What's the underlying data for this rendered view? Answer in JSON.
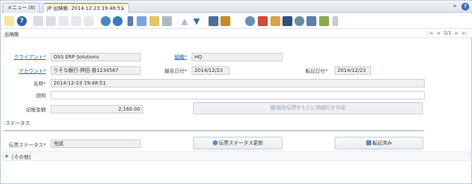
{
  "tabs": {
    "menu_label": "メニュー (8)",
    "active_label": "JP 出納帳: 2014-12-23 19:48:51",
    "close_glyph": "×"
  },
  "toolbar": {
    "icons": [
      "ignore-icon",
      "help-icon",
      "new-icon",
      "copy-icon",
      "delete-icon",
      "save-icon",
      "save-new-icon",
      "refresh-icon",
      "find-icon",
      "attachment-icon",
      "chat-icon",
      "history-icon",
      "report-icon",
      "up-icon",
      "down-icon",
      "detail-icon",
      "archive-icon",
      "zoom-icon",
      "translate-icon",
      "workflow-icon",
      "product-info-icon",
      "request-icon",
      "process-icon",
      "export-icon",
      "customize-icon"
    ]
  },
  "title": {
    "page_title": "出納帳",
    "pager_count": "1/1"
  },
  "form": {
    "client_label": "クライアント",
    "client_value": "OSS ERP Solutions",
    "org_label": "組織",
    "org_value": "HQ",
    "account_label": "アカウント",
    "account_value": "りそな銀行-押田-普1234567",
    "report_date_label": "報告日付",
    "report_date_value": "2014/12/23",
    "posting_date_label": "転記日付",
    "posting_date_value": "2014/12/23",
    "name_label": "名称",
    "name_value": "2014-12-23 19:48:51",
    "description_label": "説明",
    "description_value": "",
    "amount_label": "記帳金額",
    "amount_value": "2,160.00",
    "create_from_button": "既存伝票をもとに明細行を作成",
    "status_section": "ステータス",
    "doc_status_label": "伝票ステータス",
    "doc_status_value": "完成",
    "update_status_button": "伝票ステータス更新",
    "posted_button": "転記済み",
    "other_section": "[その他]",
    "required_mark": "*"
  },
  "colors": {
    "accent": "#f1a33a",
    "link": "#1b5fa8",
    "tab_border": "#b9c6d4"
  }
}
